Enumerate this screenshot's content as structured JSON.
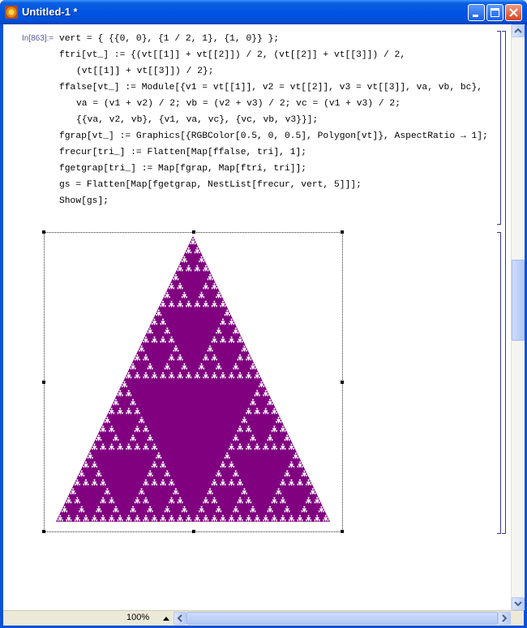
{
  "window": {
    "title": "Untitled-1 *",
    "buttons": {
      "minimize": "minimize",
      "maximize": "maximize",
      "close": "close"
    }
  },
  "cell": {
    "in_label": "In[863]:=",
    "lines": [
      "vert = { {{0, 0}, {1 / 2, 1}, {1, 0}} };",
      "ftri[vt_] := {(vt[[1]] + vt[[2]]) / 2, (vt[[2]] + vt[[3]]) / 2,",
      "(vt[[1]] + vt[[3]]) / 2};",
      "ffalse[vt_] := Module[{v1 = vt[[1]], v2 = vt[[2]], v3 = vt[[3]], va, vb, bc},",
      "va = (v1 + v2) / 2; vb = (v2 + v3) / 2; vc = (v1 + v3) / 2;",
      "{{va, v2, vb}, {v1, va, vc}, {vc, vb, v3}}];",
      "fgrap[vt_] := Graphics[{RGBColor[0.5, 0, 0.5], Polygon[vt]}, AspectRatio → 1];",
      "frecur[tri_] := Flatten[Map[ffalse, tri], 1];",
      "fgetgrap[tri_] := Map[fgrap, Map[ftri, tri]];",
      "gs = Flatten[Map[fgetgrap, NestList[frecur, vert, 5]]];",
      "Show[gs];"
    ]
  },
  "graphics": {
    "fill_color": "#800080",
    "recursion_depth": 5
  },
  "status": {
    "zoom": "100%"
  }
}
